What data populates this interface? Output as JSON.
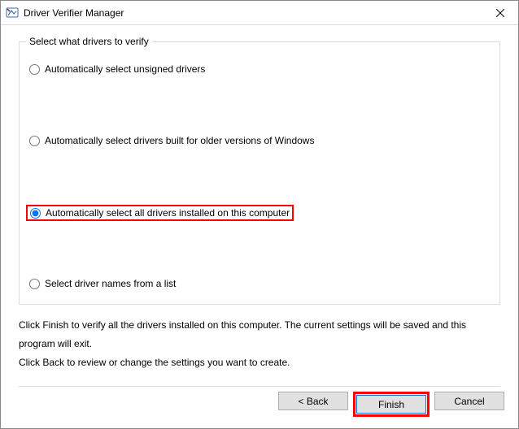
{
  "window": {
    "title": "Driver Verifier Manager",
    "close": "✕"
  },
  "groupbox": {
    "legend": "Select what drivers to verify"
  },
  "options": {
    "opt1": "Automatically select unsigned drivers",
    "opt2": "Automatically select drivers built for older versions of Windows",
    "opt3": "Automatically select all drivers installed on this computer",
    "opt4": "Select driver names from a list"
  },
  "instructions": {
    "line1": "Click Finish to verify all the drivers installed on this computer. The current settings will be saved and this program will exit.",
    "line2": "Click Back to review or change the settings you want to create."
  },
  "buttons": {
    "back": "< Back",
    "finish": "Finish",
    "cancel": "Cancel"
  }
}
